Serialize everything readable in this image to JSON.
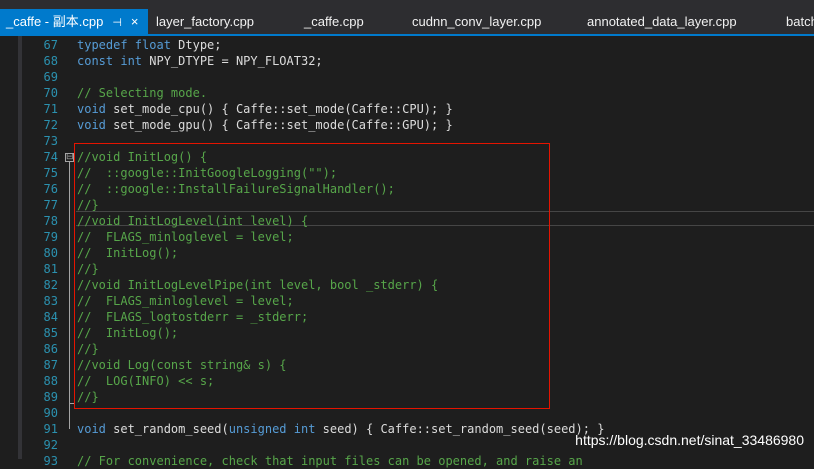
{
  "tabs": [
    {
      "label": "_caffe - 副本.cpp",
      "active": true,
      "pin_icon": "pin-icon",
      "close_icon": "close-icon"
    },
    {
      "label": "layer_factory.cpp",
      "active": false
    },
    {
      "label": "_caffe.cpp",
      "active": false
    },
    {
      "label": "cudnn_conv_layer.cpp",
      "active": false
    },
    {
      "label": "annotated_data_layer.cpp",
      "active": false
    },
    {
      "label": "batch",
      "active": false
    }
  ],
  "tab_icons": {
    "pin": "⊣",
    "close": "×"
  },
  "code_lines": [
    {
      "n": "67",
      "segs": [
        {
          "t": "typedef float",
          "c": "kw"
        },
        {
          "t": " Dtype;",
          "c": "plain"
        }
      ]
    },
    {
      "n": "68",
      "segs": [
        {
          "t": "const int",
          "c": "kw"
        },
        {
          "t": " NPY_DTYPE = NPY_FLOAT32;",
          "c": "plain"
        }
      ]
    },
    {
      "n": "69",
      "segs": []
    },
    {
      "n": "70",
      "segs": [
        {
          "t": "// Selecting mode.",
          "c": "cm"
        }
      ]
    },
    {
      "n": "71",
      "segs": [
        {
          "t": "void",
          "c": "kw"
        },
        {
          "t": " set_mode_cpu() { Caffe::set_mode(Caffe::CPU); }",
          "c": "plain"
        }
      ]
    },
    {
      "n": "72",
      "segs": [
        {
          "t": "void",
          "c": "kw"
        },
        {
          "t": " set_mode_gpu() { Caffe::set_mode(Caffe::GPU); }",
          "c": "plain"
        }
      ]
    },
    {
      "n": "73",
      "segs": []
    },
    {
      "n": "74",
      "segs": [
        {
          "t": "//void InitLog() {",
          "c": "cm"
        }
      ]
    },
    {
      "n": "75",
      "segs": [
        {
          "t": "//  ::google::InitGoogleLogging(\"\");",
          "c": "cm"
        }
      ]
    },
    {
      "n": "76",
      "segs": [
        {
          "t": "//  ::google::InstallFailureSignalHandler();",
          "c": "cm"
        }
      ]
    },
    {
      "n": "77",
      "segs": [
        {
          "t": "//}",
          "c": "cm"
        }
      ]
    },
    {
      "n": "78",
      "segs": [
        {
          "t": "//void InitLogLevel(int level) {",
          "c": "cm"
        }
      ]
    },
    {
      "n": "79",
      "segs": [
        {
          "t": "//  FLAGS_minloglevel = level;",
          "c": "cm"
        }
      ]
    },
    {
      "n": "80",
      "segs": [
        {
          "t": "//  InitLog();",
          "c": "cm"
        }
      ]
    },
    {
      "n": "81",
      "segs": [
        {
          "t": "//}",
          "c": "cm"
        }
      ]
    },
    {
      "n": "82",
      "segs": [
        {
          "t": "//void InitLogLevelPipe(int level, bool _stderr) {",
          "c": "cm"
        }
      ]
    },
    {
      "n": "83",
      "segs": [
        {
          "t": "//  FLAGS_minloglevel = level;",
          "c": "cm"
        }
      ]
    },
    {
      "n": "84",
      "segs": [
        {
          "t": "//  FLAGS_logtostderr = _stderr;",
          "c": "cm"
        }
      ]
    },
    {
      "n": "85",
      "segs": [
        {
          "t": "//  InitLog();",
          "c": "cm"
        }
      ]
    },
    {
      "n": "86",
      "segs": [
        {
          "t": "//}",
          "c": "cm"
        }
      ]
    },
    {
      "n": "87",
      "segs": [
        {
          "t": "//void Log(const string& s) {",
          "c": "cm"
        }
      ]
    },
    {
      "n": "88",
      "segs": [
        {
          "t": "//  LOG(INFO) << s;",
          "c": "cm"
        }
      ]
    },
    {
      "n": "89",
      "segs": [
        {
          "t": "//}",
          "c": "cm"
        }
      ]
    },
    {
      "n": "90",
      "segs": []
    },
    {
      "n": "91",
      "segs": [
        {
          "t": "void",
          "c": "kw"
        },
        {
          "t": " set_random_seed(",
          "c": "plain"
        },
        {
          "t": "unsigned int",
          "c": "kw"
        },
        {
          "t": " seed) { Caffe::set_random_seed(seed); }",
          "c": "plain"
        }
      ]
    },
    {
      "n": "92",
      "segs": []
    },
    {
      "n": "93",
      "segs": [
        {
          "t": "// For convenience, check that input files can be opened, and raise an",
          "c": "cm"
        }
      ]
    }
  ],
  "fold_icon": "⊟",
  "watermark": "https://blog.csdn.net/sinat_33486980",
  "colors": {
    "accent": "#007acc",
    "keyword": "#569cd6",
    "comment": "#57a64a",
    "line_number": "#2b91af",
    "highlight_box": "#e51400"
  }
}
